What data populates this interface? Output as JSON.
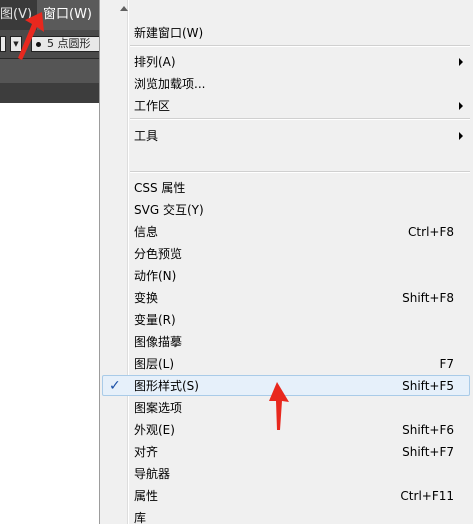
{
  "menubar": {
    "view_label": "图(V)",
    "window_label": "窗口(W)"
  },
  "toolbar": {
    "brush_label": "5 点圆形"
  },
  "menu": {
    "scroll_up_icon": "triangle-up-icon",
    "items": [
      {
        "label": "新建窗口(W)",
        "shortcut": "",
        "submenu": false
      },
      {
        "label": "排列(A)",
        "shortcut": "",
        "submenu": true
      },
      {
        "label": "浏览加载项...",
        "shortcut": "",
        "submenu": false
      },
      {
        "label": "工作区",
        "shortcut": "",
        "submenu": true
      },
      {
        "label": "工具",
        "shortcut": "",
        "submenu": true
      },
      {
        "label": "CSS 属性",
        "shortcut": "",
        "submenu": false
      },
      {
        "label": "SVG 交互(Y)",
        "shortcut": "",
        "submenu": false
      },
      {
        "label": "信息",
        "shortcut": "Ctrl+F8",
        "submenu": false
      },
      {
        "label": "分色预览",
        "shortcut": "",
        "submenu": false
      },
      {
        "label": "动作(N)",
        "shortcut": "",
        "submenu": false
      },
      {
        "label": "变换",
        "shortcut": "Shift+F8",
        "submenu": false
      },
      {
        "label": "变量(R)",
        "shortcut": "",
        "submenu": false
      },
      {
        "label": "图像描摹",
        "shortcut": "",
        "submenu": false
      },
      {
        "label": "图层(L)",
        "shortcut": "F7",
        "submenu": false
      },
      {
        "label": "图形样式(S)",
        "shortcut": "Shift+F5",
        "submenu": false,
        "checked": true,
        "highlighted": true
      },
      {
        "label": "图案选项",
        "shortcut": "",
        "submenu": false
      },
      {
        "label": "外观(E)",
        "shortcut": "Shift+F6",
        "submenu": false
      },
      {
        "label": "对齐",
        "shortcut": "Shift+F7",
        "submenu": false
      },
      {
        "label": "导航器",
        "shortcut": "",
        "submenu": false
      },
      {
        "label": "属性",
        "shortcut": "Ctrl+F11",
        "submenu": false
      },
      {
        "label": "库",
        "shortcut": "",
        "submenu": false
      }
    ],
    "check_mark": "✓"
  },
  "colors": {
    "chrome_dark": "#3a3a3a",
    "menu_bg": "#f0f0f0",
    "highlight_bg": "#e6f0fa",
    "highlight_border": "#a9cbe8",
    "annotation_red": "#e8281e"
  }
}
